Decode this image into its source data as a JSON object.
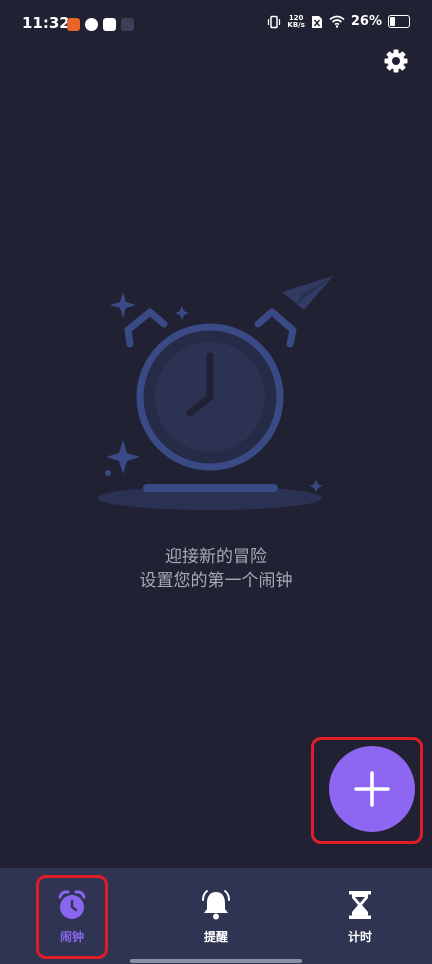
{
  "status_bar": {
    "time": "11:32",
    "net_speed_value": "120",
    "net_speed_unit": "KB/s",
    "battery": "26%"
  },
  "empty_state": {
    "line1": "迎接新的冒险",
    "line2": "设置您的第一个闹钟"
  },
  "bottom_nav": {
    "items": [
      {
        "label": "闹钟",
        "icon": "alarm-clock-icon",
        "active": true
      },
      {
        "label": "提醒",
        "icon": "bell-icon",
        "active": false
      },
      {
        "label": "计时",
        "icon": "hourglass-icon",
        "active": false
      }
    ]
  },
  "colors": {
    "background": "#202233",
    "nav_background": "#2e3451",
    "accent": "#8d66f2",
    "illustration": "#3a4a86",
    "highlight_frame": "#e21d2a"
  }
}
